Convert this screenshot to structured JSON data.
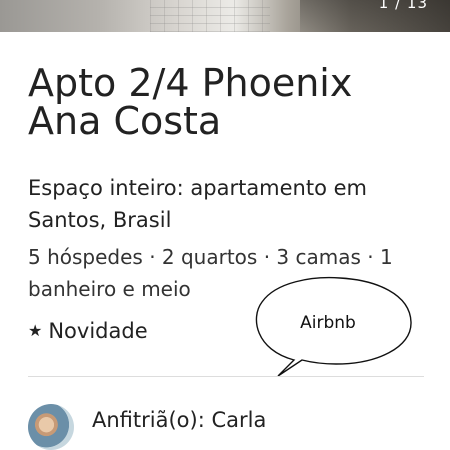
{
  "photo": {
    "counter": "1 / 13"
  },
  "listing": {
    "title": "Apto 2/4 Phoenix Ana Costa",
    "subtitle": "Espaço inteiro: apartamento em Santos, Brasil",
    "details": "5 hóspedes · 2 quartos · 3 camas · 1 banheiro e meio",
    "badge_icon": "star-icon",
    "badge": "Novidade"
  },
  "annotation": {
    "label": "Airbnb"
  },
  "host": {
    "label": "Anfitriã(o): Carla"
  }
}
